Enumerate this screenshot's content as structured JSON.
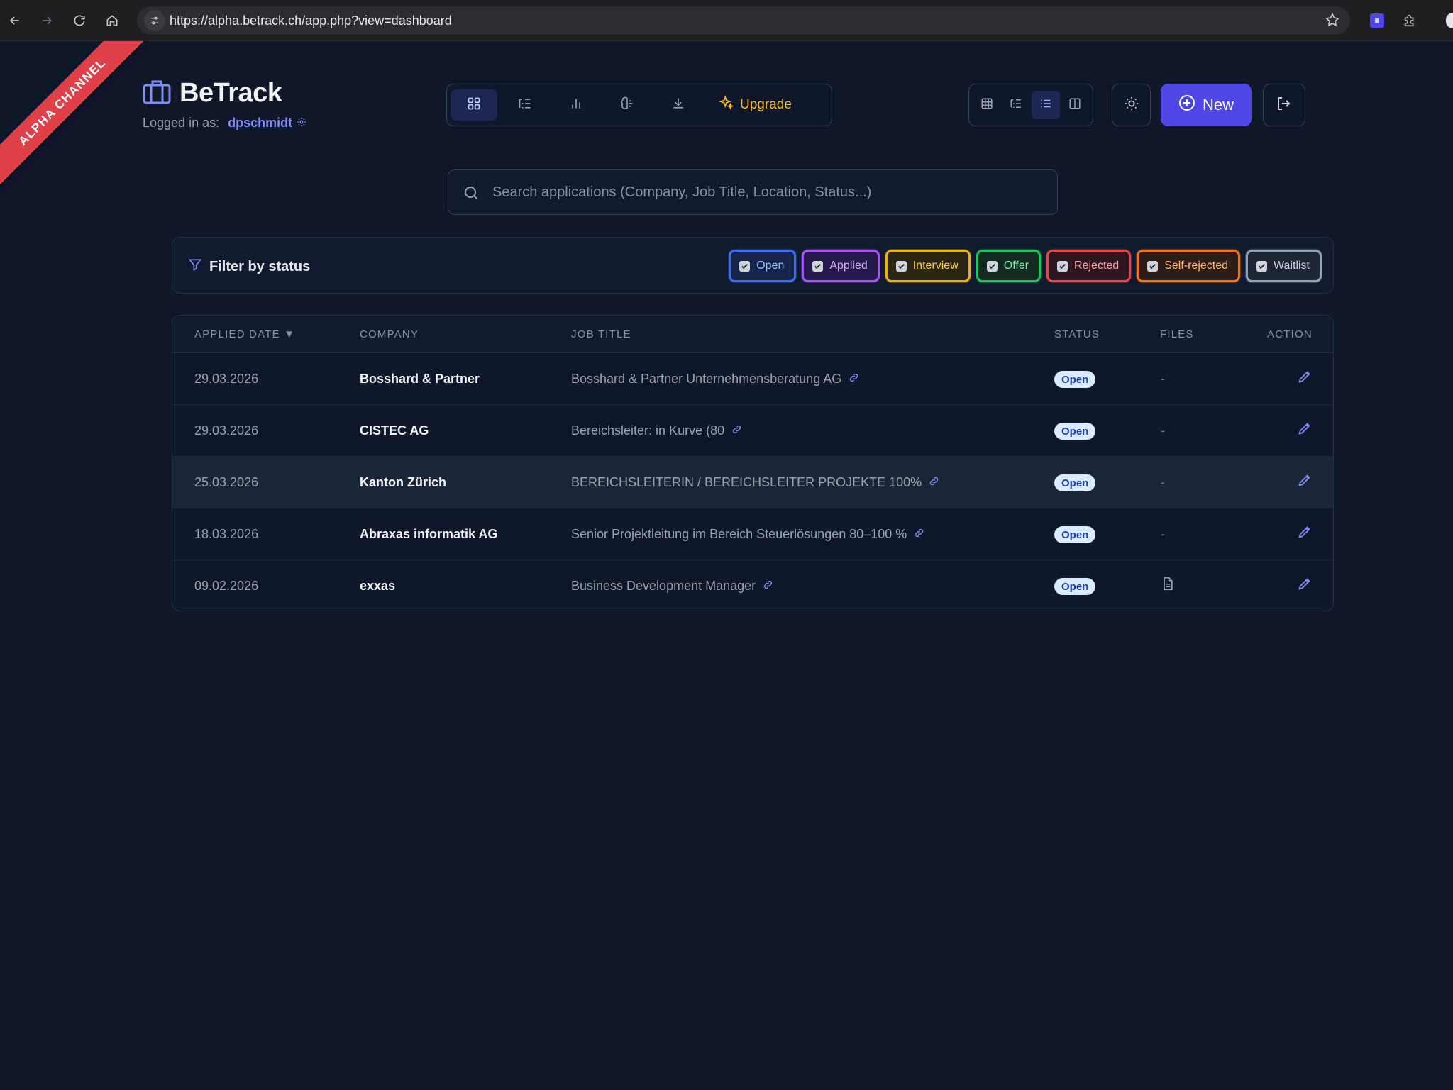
{
  "browser": {
    "url": "https://alpha.betrack.ch/app.php?view=dashboard"
  },
  "ribbon": "ALPHA CHANNEL",
  "app": {
    "name": "BeTrack",
    "logged_in_label": "Logged in as:",
    "username": "dpschmidt"
  },
  "toolbar": {
    "upgrade_label": "Upgrade"
  },
  "actions": {
    "new_label": "New"
  },
  "search": {
    "placeholder": "Search applications (Company, Job Title, Location, Status...)"
  },
  "filter": {
    "title": "Filter by status",
    "chips": [
      {
        "label": "Open",
        "color": "#3b6cf6",
        "text_color": "#93c5fd",
        "bg": "#16234a"
      },
      {
        "label": "Applied",
        "color": "#a855f7",
        "text_color": "#d8b4fe",
        "bg": "#25184a"
      },
      {
        "label": "Interview",
        "color": "#eab308",
        "text_color": "#fcd34d",
        "bg": "#2a2514"
      },
      {
        "label": "Offer",
        "color": "#22c55e",
        "text_color": "#86efac",
        "bg": "#122a20"
      },
      {
        "label": "Rejected",
        "color": "#ef4444",
        "text_color": "#fca5a5",
        "bg": "#2e1620"
      },
      {
        "label": "Self-rejected",
        "color": "#f97316",
        "text_color": "#fdba74",
        "bg": "#2e1c16"
      },
      {
        "label": "Waitlist",
        "color": "#94a3b8",
        "text_color": "#cbd5e1",
        "bg": "#1e2636"
      }
    ]
  },
  "table": {
    "headers": {
      "applied_date": "APPLIED DATE ▼",
      "company": "COMPANY",
      "job_title": "JOB TITLE",
      "status": "STATUS",
      "files": "FILES",
      "action": "ACTION"
    },
    "rows": [
      {
        "date": "29.03.2026",
        "company": "Bosshard & Partner",
        "title": "Bosshard & Partner Unternehmensberatung AG",
        "status": "Open",
        "files": "-"
      },
      {
        "date": "29.03.2026",
        "company": "CISTEC AG",
        "title": "Bereichsleiter: in Kurve (80",
        "status": "Open",
        "files": "-"
      },
      {
        "date": "25.03.2026",
        "company": "Kanton Zürich",
        "title": "BEREICHSLEITERIN / BEREICHSLEITER PROJEKTE 100%",
        "status": "Open",
        "files": "-"
      },
      {
        "date": "18.03.2026",
        "company": "Abraxas informatik AG",
        "title": "Senior Projektleitung im Bereich Steuerlösungen 80–100 %",
        "status": "Open",
        "files": "-"
      },
      {
        "date": "09.02.2026",
        "company": "exxas",
        "title": "Business Development Manager",
        "status": "Open",
        "files": "file-icon"
      }
    ]
  },
  "colors": {
    "accent": "#4f46e5",
    "link": "#818cf8",
    "background": "#0f1729"
  }
}
